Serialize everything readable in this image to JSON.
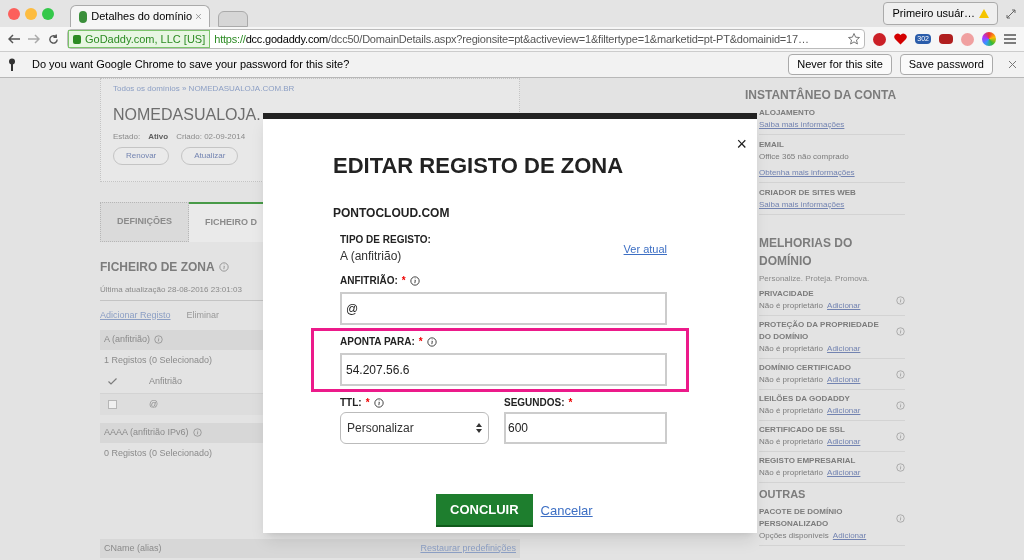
{
  "browser": {
    "tab_title": "Detalhes do domínio",
    "profile": "Primeiro usuár…",
    "identity": "GoDaddy.com, LLC [US]",
    "url_scheme": "https://",
    "url_host": "dcc.godaddy.com",
    "url_path": "/dcc50/DomainDetails.aspx?regionsite=pt&activeview=1&filtertype=1&marketid=pt-PT&domainid=17…",
    "extension_badge": "302",
    "infobar": {
      "message": "Do you want Google Chrome to save your password for this site?",
      "buttons": [
        "Never for this site",
        "Save password"
      ]
    }
  },
  "page": {
    "breadcrumb": "Todos os domínios » NOMEDASUALOJA.COM.BR",
    "domain_title": "NOMEDASUALOJA.",
    "status_label": "Estado:",
    "status_value": "Ativo",
    "created": "Criado: 02-09-2014",
    "actions": [
      "Renovar",
      "Atualizar"
    ],
    "tabs": [
      {
        "label": "DEFINIÇÕES",
        "selected": false
      },
      {
        "label": "FICHEIRO D",
        "selected": true
      }
    ],
    "zone_title": "FICHEIRO DE ZONA",
    "last_update": "Última atualização 28-08-2016 23:01:03",
    "add_record": "Adicionar Registo",
    "delete": "Eliminar",
    "groups": [
      {
        "title": "A (anfitrião)",
        "count": "1 Registos (0 Selecionado)",
        "header": "Anfitrião",
        "rows": [
          {
            "host": "@",
            "checked": false
          }
        ]
      },
      {
        "title": "AAAA (anfitrião IPv6)",
        "count": "0 Registos (0 Selecionado)"
      }
    ],
    "cname_title": "CName (alias)",
    "restore": "Restaurar predefinições"
  },
  "sidebar": {
    "account_title": "INSTANTÂNEO DA CONTA",
    "account_items": [
      {
        "name": "ALOJAMENTO",
        "link": "Saiba mais informações"
      },
      {
        "name": "EMAIL",
        "note": "Office 365 não comprado",
        "link": "Obtenha mais informações"
      },
      {
        "name": "CRIADOR DE SITES WEB",
        "link": "Saiba mais informações"
      }
    ],
    "upgrades_title": "MELHORIAS DO DOMÍNIO",
    "upgrades_subtitle": "Personalize. Proteja. Promova.",
    "upgrades": [
      {
        "name": "PRIVACIDADE",
        "note": "Não é proprietário",
        "link": "Adicionar"
      },
      {
        "name": "PROTEÇÃO DA PROPRIEDADE DO DOMÍNIO",
        "note": "Não é proprietário",
        "link": "Adicionar"
      },
      {
        "name": "DOMÍNIO CERTIFICADO",
        "note": "Não é proprietário",
        "link": "Adicionar"
      },
      {
        "name": "LEILÕES DA GODADDY",
        "note": "Não é proprietário",
        "link": "Adicionar"
      },
      {
        "name": "CERTIFICADO DE SSL",
        "note": "Não é proprietário",
        "link": "Adicionar"
      },
      {
        "name": "REGISTO EMPRESARIAL",
        "note": "Não é proprietário",
        "link": "Adicionar"
      }
    ],
    "other_title": "OUTRAS",
    "other": [
      {
        "name": "PACOTE DE DOMÍNIO PERSONALIZADO",
        "note": "Opções disponíveis",
        "link": "Adicionar"
      }
    ]
  },
  "modal": {
    "close": "×",
    "title": "EDITAR REGISTO DE ZONA",
    "domain": "PONTOCLOUD.COM",
    "record_type_label": "TIPO DE REGISTO:",
    "record_type_value": "A (anfitrião)",
    "view_current": "Ver atual",
    "fields": [
      {
        "label": "ANFITRIÃO:",
        "required_mark": "*",
        "value": "@",
        "highlighted": false
      },
      {
        "label": "APONTA PARA:",
        "required_mark": "*",
        "value": "54.207.56.6",
        "highlighted": true
      }
    ],
    "ttl": {
      "label": "TTL:",
      "required_mark": "*",
      "value": "Personalizar"
    },
    "seconds": {
      "label": "SEGUNDOS:",
      "required_mark": "*",
      "value": "600"
    },
    "confirm": "CONCLUIR",
    "cancel": "Cancelar"
  }
}
